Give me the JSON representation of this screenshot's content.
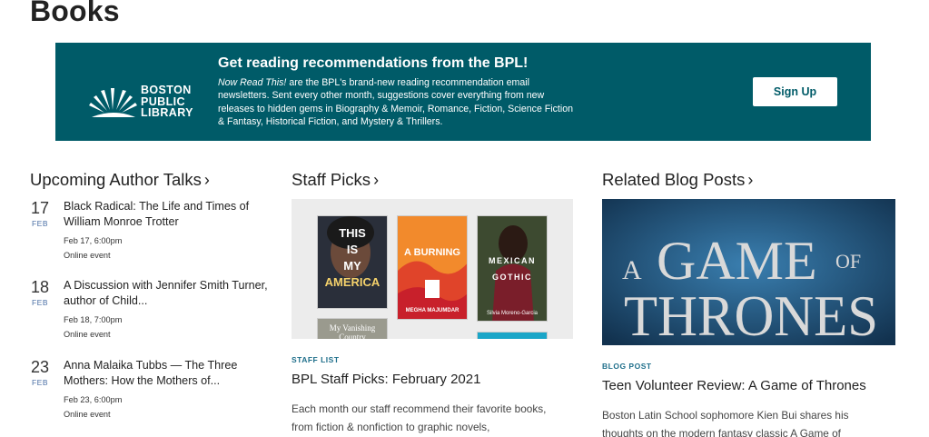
{
  "page": {
    "title": "Books"
  },
  "banner": {
    "logo": {
      "line1": "BOSTON",
      "line2": "PUBLIC",
      "line3": "LIBRARY"
    },
    "heading": "Get reading recommendations from the BPL!",
    "text_em": "Now Read This!",
    "text_rest": " are the BPL's brand-new reading recommendation email newsletters. Sent every other month, suggestions cover everything from new releases to hidden gems in Biography & Memoir, Romance, Fiction, Science Fiction & Fantasy, Historical Fiction, and Mystery & Thrillers.",
    "button_label": "Sign Up",
    "color": "#005b68"
  },
  "author_talks": {
    "heading": "Upcoming Author Talks",
    "events": [
      {
        "day": "17",
        "month": "FEB",
        "title": "Black Radical: The Life and Times of William Monroe Trotter",
        "date": "Feb 17, 6:00pm",
        "location": "Online event"
      },
      {
        "day": "18",
        "month": "FEB",
        "title": "A Discussion with Jennifer Smith Turner, author of Child...",
        "date": "Feb 18, 7:00pm",
        "location": "Online event"
      },
      {
        "day": "23",
        "month": "FEB",
        "title": "Anna Malaika Tubbs — The Three Mothers: How the Mothers of...",
        "date": "Feb 23, 6:00pm",
        "location": "Online event"
      }
    ]
  },
  "staff_picks": {
    "heading": "Staff Picks",
    "covers": [
      {
        "lines": [
          "THIS",
          "IS",
          "MY",
          "AMERICA"
        ]
      },
      {
        "lines": [
          "A BURNING"
        ],
        "sub": "MEGHA MAJUMDAR"
      },
      {
        "lines": [
          "MEXICAN",
          "GOTHIC"
        ],
        "sub": "Silvia Moreno-Garcia"
      },
      {
        "lines": [
          "My Vanishing Country"
        ]
      }
    ],
    "tag": "STAFF LIST",
    "title": "BPL Staff Picks: February 2021",
    "text": "Each month our staff recommend their favorite books, from fiction & nonfiction to graphic novels,"
  },
  "blog": {
    "heading": "Related Blog Posts",
    "image_text": {
      "a": "A",
      "game": "GAME",
      "of": "OF",
      "thrones": "THRONES"
    },
    "tag": "BLOG POST",
    "title": "Teen Volunteer Review: A Game of Thrones",
    "text": "Boston Latin School sophomore Kien Bui shares his thoughts on the modern fantasy classic A Game of"
  }
}
